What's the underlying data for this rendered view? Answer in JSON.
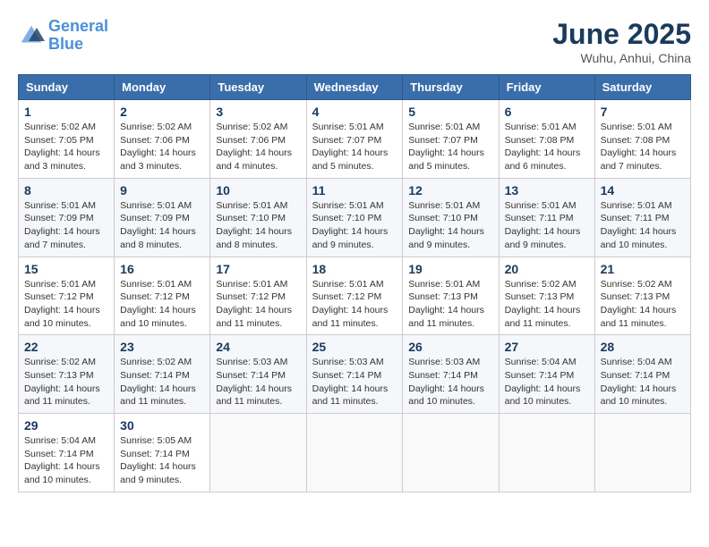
{
  "logo": {
    "line1": "General",
    "line2": "Blue"
  },
  "title": "June 2025",
  "location": "Wuhu, Anhui, China",
  "days_of_week": [
    "Sunday",
    "Monday",
    "Tuesday",
    "Wednesday",
    "Thursday",
    "Friday",
    "Saturday"
  ],
  "weeks": [
    [
      {
        "day": 1,
        "info": "Sunrise: 5:02 AM\nSunset: 7:05 PM\nDaylight: 14 hours\nand 3 minutes."
      },
      {
        "day": 2,
        "info": "Sunrise: 5:02 AM\nSunset: 7:06 PM\nDaylight: 14 hours\nand 3 minutes."
      },
      {
        "day": 3,
        "info": "Sunrise: 5:02 AM\nSunset: 7:06 PM\nDaylight: 14 hours\nand 4 minutes."
      },
      {
        "day": 4,
        "info": "Sunrise: 5:01 AM\nSunset: 7:07 PM\nDaylight: 14 hours\nand 5 minutes."
      },
      {
        "day": 5,
        "info": "Sunrise: 5:01 AM\nSunset: 7:07 PM\nDaylight: 14 hours\nand 5 minutes."
      },
      {
        "day": 6,
        "info": "Sunrise: 5:01 AM\nSunset: 7:08 PM\nDaylight: 14 hours\nand 6 minutes."
      },
      {
        "day": 7,
        "info": "Sunrise: 5:01 AM\nSunset: 7:08 PM\nDaylight: 14 hours\nand 7 minutes."
      }
    ],
    [
      {
        "day": 8,
        "info": "Sunrise: 5:01 AM\nSunset: 7:09 PM\nDaylight: 14 hours\nand 7 minutes."
      },
      {
        "day": 9,
        "info": "Sunrise: 5:01 AM\nSunset: 7:09 PM\nDaylight: 14 hours\nand 8 minutes."
      },
      {
        "day": 10,
        "info": "Sunrise: 5:01 AM\nSunset: 7:10 PM\nDaylight: 14 hours\nand 8 minutes."
      },
      {
        "day": 11,
        "info": "Sunrise: 5:01 AM\nSunset: 7:10 PM\nDaylight: 14 hours\nand 9 minutes."
      },
      {
        "day": 12,
        "info": "Sunrise: 5:01 AM\nSunset: 7:10 PM\nDaylight: 14 hours\nand 9 minutes."
      },
      {
        "day": 13,
        "info": "Sunrise: 5:01 AM\nSunset: 7:11 PM\nDaylight: 14 hours\nand 9 minutes."
      },
      {
        "day": 14,
        "info": "Sunrise: 5:01 AM\nSunset: 7:11 PM\nDaylight: 14 hours\nand 10 minutes."
      }
    ],
    [
      {
        "day": 15,
        "info": "Sunrise: 5:01 AM\nSunset: 7:12 PM\nDaylight: 14 hours\nand 10 minutes."
      },
      {
        "day": 16,
        "info": "Sunrise: 5:01 AM\nSunset: 7:12 PM\nDaylight: 14 hours\nand 10 minutes."
      },
      {
        "day": 17,
        "info": "Sunrise: 5:01 AM\nSunset: 7:12 PM\nDaylight: 14 hours\nand 11 minutes."
      },
      {
        "day": 18,
        "info": "Sunrise: 5:01 AM\nSunset: 7:12 PM\nDaylight: 14 hours\nand 11 minutes."
      },
      {
        "day": 19,
        "info": "Sunrise: 5:01 AM\nSunset: 7:13 PM\nDaylight: 14 hours\nand 11 minutes."
      },
      {
        "day": 20,
        "info": "Sunrise: 5:02 AM\nSunset: 7:13 PM\nDaylight: 14 hours\nand 11 minutes."
      },
      {
        "day": 21,
        "info": "Sunrise: 5:02 AM\nSunset: 7:13 PM\nDaylight: 14 hours\nand 11 minutes."
      }
    ],
    [
      {
        "day": 22,
        "info": "Sunrise: 5:02 AM\nSunset: 7:13 PM\nDaylight: 14 hours\nand 11 minutes."
      },
      {
        "day": 23,
        "info": "Sunrise: 5:02 AM\nSunset: 7:14 PM\nDaylight: 14 hours\nand 11 minutes."
      },
      {
        "day": 24,
        "info": "Sunrise: 5:03 AM\nSunset: 7:14 PM\nDaylight: 14 hours\nand 11 minutes."
      },
      {
        "day": 25,
        "info": "Sunrise: 5:03 AM\nSunset: 7:14 PM\nDaylight: 14 hours\nand 11 minutes."
      },
      {
        "day": 26,
        "info": "Sunrise: 5:03 AM\nSunset: 7:14 PM\nDaylight: 14 hours\nand 10 minutes."
      },
      {
        "day": 27,
        "info": "Sunrise: 5:04 AM\nSunset: 7:14 PM\nDaylight: 14 hours\nand 10 minutes."
      },
      {
        "day": 28,
        "info": "Sunrise: 5:04 AM\nSunset: 7:14 PM\nDaylight: 14 hours\nand 10 minutes."
      }
    ],
    [
      {
        "day": 29,
        "info": "Sunrise: 5:04 AM\nSunset: 7:14 PM\nDaylight: 14 hours\nand 10 minutes."
      },
      {
        "day": 30,
        "info": "Sunrise: 5:05 AM\nSunset: 7:14 PM\nDaylight: 14 hours\nand 9 minutes."
      },
      null,
      null,
      null,
      null,
      null
    ]
  ]
}
